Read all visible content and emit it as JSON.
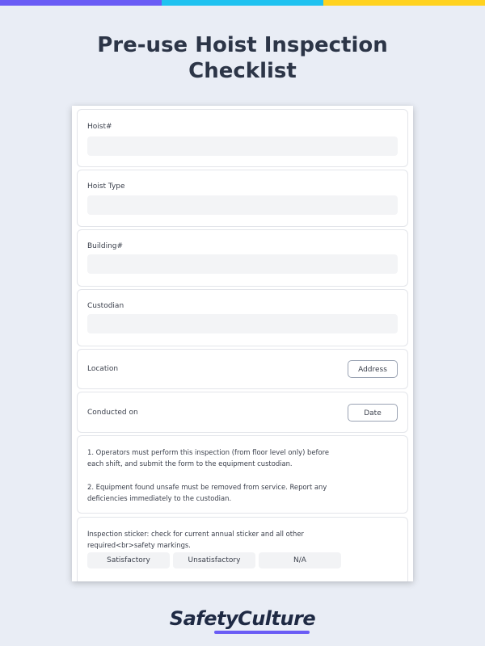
{
  "topbar_colors": [
    "#6a5cf5",
    "#1fc2f0",
    "#ffd21f"
  ],
  "title": "Pre-use Hoist Inspection\nChecklist",
  "fields": [
    {
      "label": "Hoist#"
    },
    {
      "label": "Hoist Type"
    },
    {
      "label": "Building#"
    },
    {
      "label": "Custodian"
    }
  ],
  "location": {
    "label": "Location",
    "button": "Address"
  },
  "conducted": {
    "label": "Conducted on",
    "button": "Date"
  },
  "instructions": {
    "p1": "1. Operators must perform this inspection (from floor level only) before each shift, and submit the form to the equipment custodian.",
    "p2": "2. Equipment found unsafe must be removed from service. Report any deficiencies immediately to the custodian."
  },
  "sticker": {
    "question": "Inspection sticker: check for current annual sticker and all other required<br>safety markings.",
    "options": [
      "Satisfactory",
      "Unsatisfactory",
      "N/A"
    ]
  },
  "brand": {
    "name": "SafetyCulture",
    "accent": "#6a5cf5"
  }
}
